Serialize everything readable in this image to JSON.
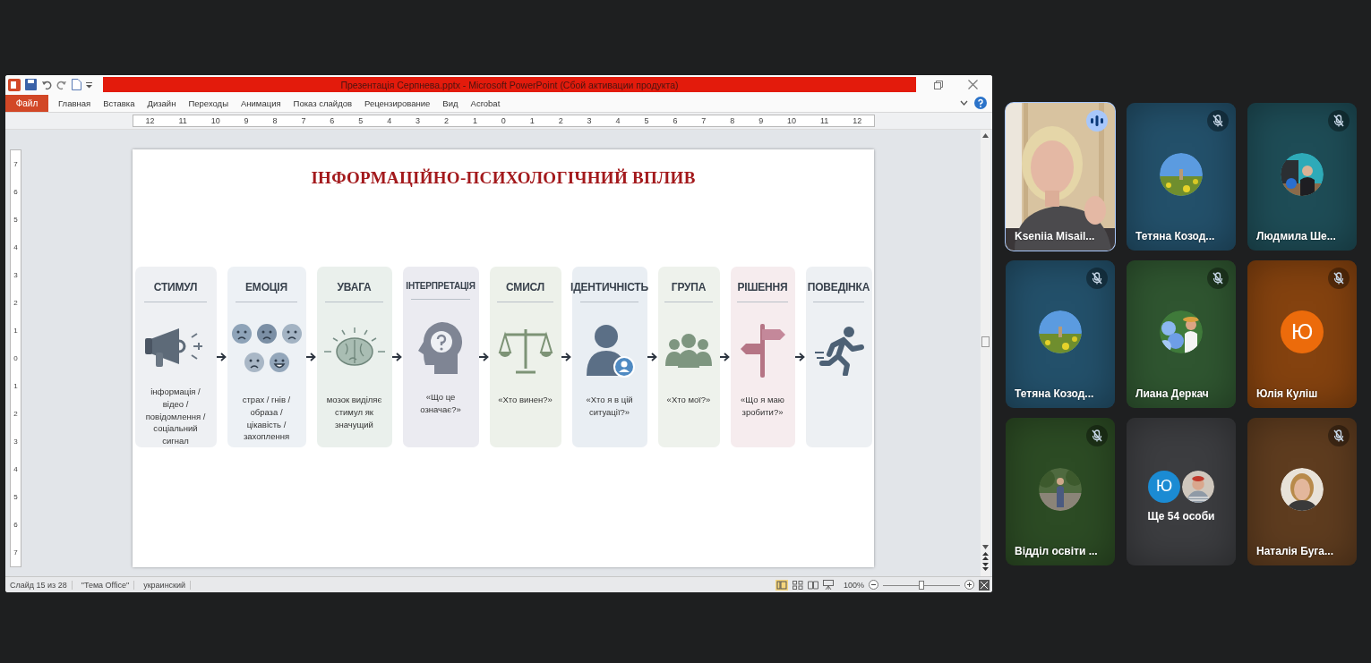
{
  "powerpoint": {
    "title": "Презентація Серпнева.pptx - Microsoft PowerPoint (Сбой активации продукта)",
    "file_tab": "Файл",
    "tabs": [
      {
        "label": "Главная",
        "selected": false
      },
      {
        "label": "Вставка",
        "selected": false
      },
      {
        "label": "Дизайн",
        "selected": false
      },
      {
        "label": "Переходы",
        "selected": false
      },
      {
        "label": "Анимация",
        "selected": false
      },
      {
        "label": "Показ слайдов",
        "selected": false
      },
      {
        "label": "Рецензирование",
        "selected": false
      },
      {
        "label": "Вид",
        "selected": false
      },
      {
        "label": "Acrobat",
        "selected": false
      }
    ],
    "ruler_h": [
      "12",
      "11",
      "10",
      "9",
      "8",
      "7",
      "6",
      "5",
      "4",
      "3",
      "2",
      "1",
      "0",
      "1",
      "2",
      "3",
      "4",
      "5",
      "6",
      "7",
      "8",
      "9",
      "10",
      "11",
      "12"
    ],
    "ruler_v": [
      "7",
      "6",
      "5",
      "4",
      "3",
      "2",
      "1",
      "0",
      "1",
      "2",
      "3",
      "4",
      "5",
      "6",
      "7"
    ],
    "slide": {
      "title": "ІНФОРМАЦІЙНО-ПСИХОЛОГІЧНИЙ ВПЛИВ",
      "steps": [
        {
          "title": "СТИМУЛ",
          "caption": "інформація / відео / повідомлення / соціальний сигнал",
          "color": "#eef0f3"
        },
        {
          "title": "ЕМОЦІЯ",
          "caption": "страх / гнів / образа / цікавість / захоплення",
          "color": "#edf1f5"
        },
        {
          "title": "УВАГА",
          "caption": "мозок виділяє стимул як значущий",
          "color": "#eaf0ec"
        },
        {
          "title": "ІНТЕРПРЕТАЦІЯ",
          "caption": "«Що це означає?»",
          "color": "#ebebf1"
        },
        {
          "title": "СМИСЛ",
          "caption": "«Хто винен?»",
          "color": "#edf1ea"
        },
        {
          "title": "ІДЕНТИЧНІСТЬ",
          "caption": "«Хто я в цій ситуації?»",
          "color": "#e9eef3"
        },
        {
          "title": "ГРУПА",
          "caption": "«Хто мої?»",
          "color": "#eef2ec"
        },
        {
          "title": "РІШЕННЯ",
          "caption": "«Що я маю зробити?»",
          "color": "#f6ecee"
        },
        {
          "title": "ПОВЕДІНКА",
          "color": "#edf0f3"
        }
      ]
    },
    "status_bar": {
      "slide": "Слайд 15 из 28",
      "theme": "\"Тема Office\"",
      "language": "украинский",
      "zoom": "100%",
      "zoom_slider": {
        "level": 0.5
      }
    }
  },
  "participants": [
    {
      "kind": "video",
      "name": "Kseniia Misail...",
      "speaking": true,
      "muted": false
    },
    {
      "kind": "avatar",
      "name": "Тетяна Козод...",
      "speaking": false,
      "muted": true,
      "color": "#23506a",
      "avatar": {
        "kind": "picture"
      }
    },
    {
      "kind": "avatar",
      "name": "Людмила Ше...",
      "speaking": false,
      "muted": true,
      "color": "#1e4c56",
      "avatar": {
        "kind": "picture"
      }
    },
    {
      "kind": "avatar",
      "name": "Тетяна Козод...",
      "speaking": false,
      "muted": true,
      "color": "#23506a",
      "avatar": {
        "kind": "picture"
      }
    },
    {
      "kind": "avatar",
      "name": "Лиана Деркач",
      "speaking": false,
      "muted": true,
      "color": "#2f5530",
      "avatar": {
        "kind": "picture"
      }
    },
    {
      "kind": "avatar",
      "name": "Юлія Куліш",
      "speaking": false,
      "muted": true,
      "color": "#84420f",
      "avatar": {
        "kind": "initial",
        "text": "Ю",
        "color": "#ec6b0b"
      }
    },
    {
      "kind": "avatar",
      "name": "Відділ освіти ...",
      "speaking": false,
      "muted": true,
      "color": "#2c4b24",
      "avatar": {
        "kind": "picture"
      }
    },
    {
      "kind": "overflow",
      "count": "Ще 54 особи",
      "color": "#3c3d40",
      "avatars": [
        {
          "kind": "initial",
          "text": "Ю",
          "color": "#1b8bd3"
        },
        {
          "kind": "picture"
        }
      ]
    },
    {
      "kind": "avatar",
      "name": "Наталія Буга...",
      "speaking": false,
      "muted": true,
      "color": "#5e3c1f",
      "avatar": {
        "kind": "picture"
      }
    }
  ]
}
